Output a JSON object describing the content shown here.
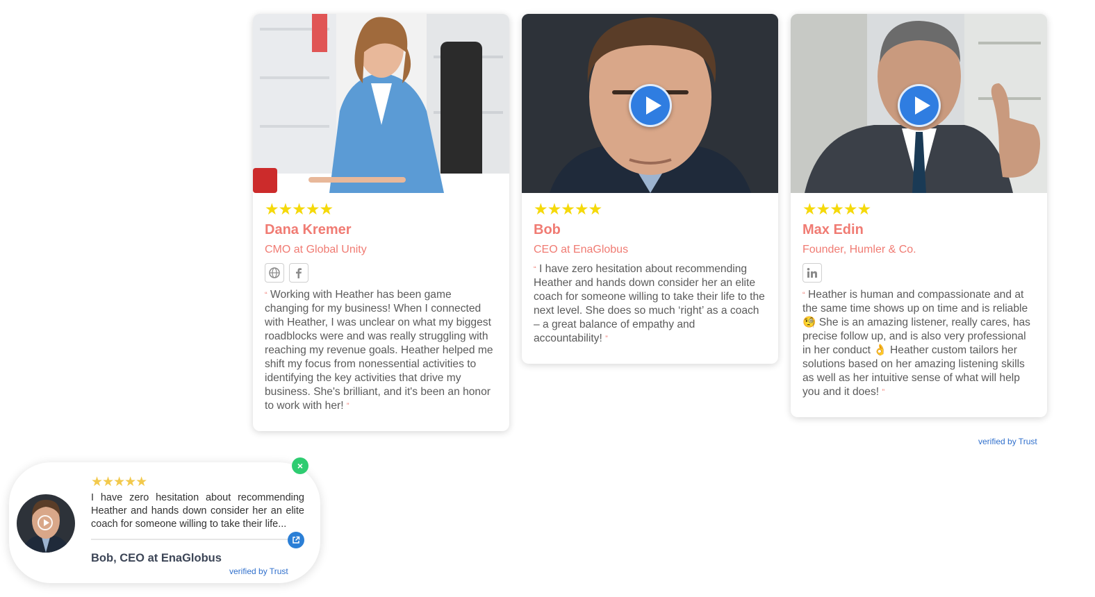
{
  "testimonials": [
    {
      "stars": "★★★★★",
      "name": "Dana Kremer",
      "role": "CMO at Global Unity",
      "socials": [
        "globe-icon",
        "facebook-icon"
      ],
      "quote": "Working with Heather has been game changing for my business! When I connected with Heather, I was unclear on what my biggest roadblocks were and was really struggling with reaching my revenue goals. Heather helped me shift my focus from nonessential activities to identifying the key activities that drive my business. She's brilliant, and it's been an honor to work with her!",
      "has_video": false
    },
    {
      "stars": "★★★★★",
      "name": "Bob",
      "role": "CEO at EnaGlobus",
      "socials": [],
      "quote": "I have zero hesitation about recommending Heather and hands down consider her an elite coach for someone willing to take their life to the next level. She does so much ‘right’ as a coach – a great balance of empathy and accountability!",
      "has_video": true
    },
    {
      "stars": "★★★★★",
      "name": "Max Edin",
      "role": "Founder, Humler & Co.",
      "socials": [
        "linkedin-icon"
      ],
      "quote": "Heather is human and compassionate and at the same time shows up on time and is reliable 🧐 She is an amazing listener, really cares, has precise follow up, and is also very professional in her conduct 👌 Heather custom tailors her solutions based on her amazing listening skills as well as her intuitive sense of what will help you and it does!",
      "has_video": true
    }
  ],
  "quote_marks": {
    "open": "“",
    "close": "”"
  },
  "verified_label": "verified by Trust",
  "popup": {
    "stars": "★★★★★",
    "text": "I have zero hesitation about recommending Heather and hands down consider her an elite coach for someone willing to take their life...",
    "author": "Bob, CEO at EnaGlobus",
    "verified": "verified by Trust",
    "close_symbol": "×"
  },
  "colors": {
    "accent": "#f07b73",
    "star": "#f5d90a",
    "play": "#2f7de1",
    "close": "#2ecc71",
    "link": "#2f6fcc"
  }
}
